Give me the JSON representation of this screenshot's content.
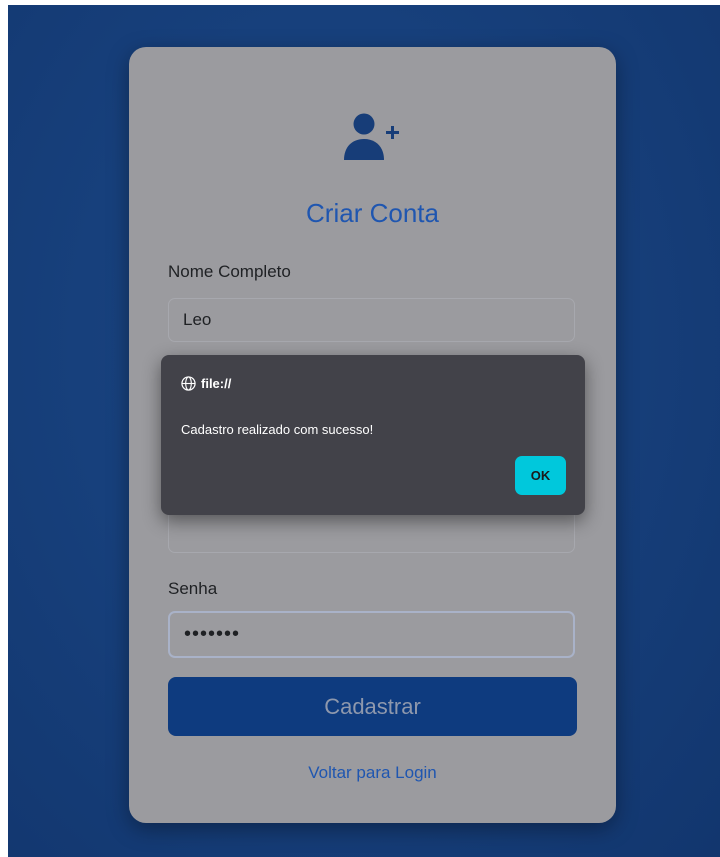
{
  "form": {
    "title": "Criar Conta",
    "name_label": "Nome Completo",
    "name_value": "Leo",
    "password_label": "Senha",
    "password_value": "•••••••",
    "submit_label": "Cadastrar",
    "back_link": "Voltar para Login",
    "icon": "user-plus-icon"
  },
  "dialog": {
    "origin": "file://",
    "message": "Cadastro realizado com sucesso!",
    "ok_label": "OK",
    "icon": "globe-icon"
  },
  "colors": {
    "background": "#17407c",
    "card": "#9b9b9f",
    "accent": "#1f56b0",
    "button": "#0e3b7f",
    "dialog": "#424249",
    "dialog_button": "#00c8dc"
  }
}
